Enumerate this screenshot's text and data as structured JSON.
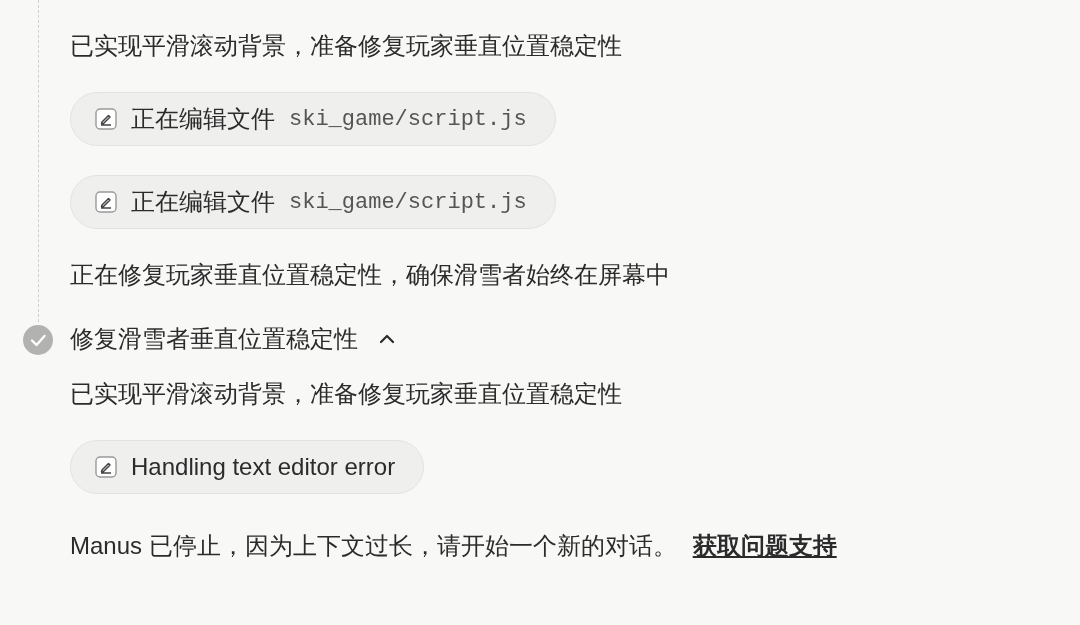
{
  "sections": [
    {
      "kind": "continuation",
      "items": [
        {
          "kind": "text",
          "text": "已实现平滑滚动背景，准备修复玩家垂直位置稳定性"
        },
        {
          "kind": "chip",
          "label": "正在编辑文件",
          "path": "ski_game/script.js"
        },
        {
          "kind": "chip",
          "label": "正在编辑文件",
          "path": "ski_game/script.js"
        },
        {
          "kind": "text",
          "text": "正在修复玩家垂直位置稳定性，确保滑雪者始终在屏幕中"
        }
      ]
    },
    {
      "kind": "step",
      "title": "修复滑雪者垂直位置稳定性",
      "completed": true,
      "expanded": true,
      "items": [
        {
          "kind": "text",
          "text": "已实现平滑滚动背景，准备修复玩家垂直位置稳定性"
        },
        {
          "kind": "chip",
          "label": "Handling text editor error"
        }
      ]
    }
  ],
  "footer": {
    "message": "Manus 已停止，因为上下文过长，请开始一个新的对话。",
    "link": "获取问题支持"
  }
}
